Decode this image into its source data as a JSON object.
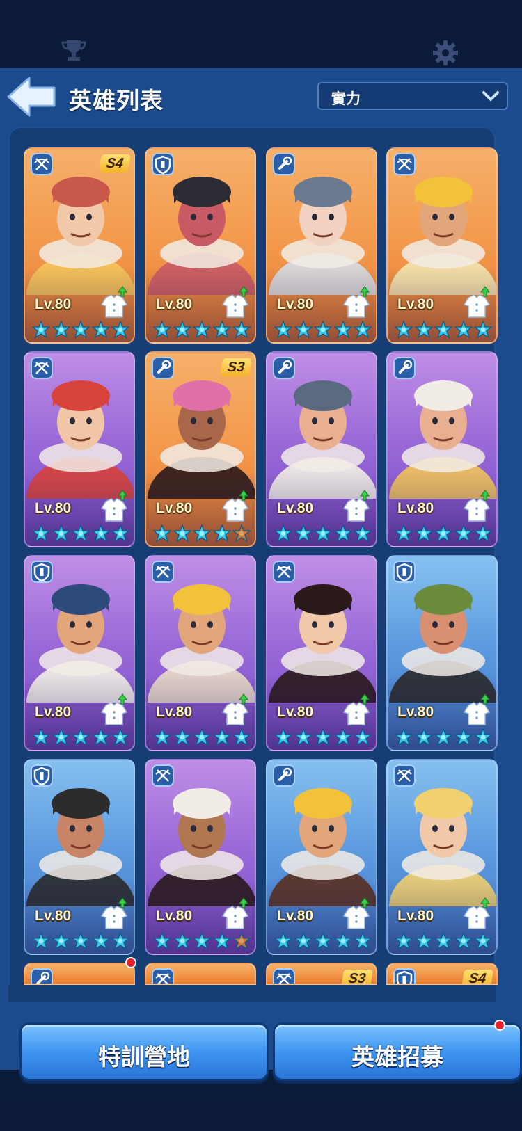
{
  "header": {
    "title": "英雄列表",
    "sort": {
      "selected": "實力"
    }
  },
  "heroes": [
    {
      "tier": "orange",
      "role": "crossbow-icon",
      "badge": "S4",
      "level": "Lv.80",
      "stars": 5,
      "skin": "#f1c9a8",
      "hat": "#c9584c",
      "hair": "#f2c45c"
    },
    {
      "tier": "orange",
      "role": "shield-icon",
      "badge": "",
      "level": "Lv.80",
      "stars": 5,
      "skin": "#c85a66",
      "hat": "#2c2c34",
      "hair": "#c85a66"
    },
    {
      "tier": "orange",
      "role": "wrench-icon",
      "badge": "",
      "level": "Lv.80",
      "stars": 5,
      "skin": "#f2d2c0",
      "hat": "#6a7a90",
      "hair": "#d6dbe6"
    },
    {
      "tier": "orange",
      "role": "crossbow-icon",
      "badge": "",
      "level": "Lv.80",
      "stars": 5,
      "skin": "#e2a67a",
      "hat": "#f2c23a",
      "hair": "#f2e6b0"
    },
    {
      "tier": "purple",
      "role": "crossbow-icon",
      "badge": "",
      "level": "Lv.80",
      "stars": 5,
      "skin": "#f1c6a6",
      "hat": "#d8443c",
      "hair": "#d8443c"
    },
    {
      "tier": "orange",
      "role": "wrench-icon",
      "badge": "S3",
      "level": "Lv.80",
      "stars": 4,
      "skin": "#a8664a",
      "hat": "#e070a8",
      "hair": "#2a1a1a"
    },
    {
      "tier": "purple",
      "role": "wrench-icon",
      "badge": "",
      "level": "Lv.80",
      "stars": 5,
      "skin": "#e8b090",
      "hat": "#5a6a80",
      "hair": "#f2efe6"
    },
    {
      "tier": "purple",
      "role": "wrench-icon",
      "badge": "",
      "level": "Lv.80",
      "stars": 5,
      "skin": "#e8b090",
      "hat": "#f2ece6",
      "hair": "#f2c45c"
    },
    {
      "tier": "purple",
      "role": "shield-icon",
      "badge": "",
      "level": "Lv.80",
      "stars": 5,
      "skin": "#e2a67a",
      "hat": "#2c4a7a",
      "hair": "#f2efe6"
    },
    {
      "tier": "purple",
      "role": "crossbow-icon",
      "badge": "",
      "level": "Lv.80",
      "stars": 5,
      "skin": "#e2a67a",
      "hat": "#f2c23a",
      "hair": "#e8dcc6"
    },
    {
      "tier": "purple",
      "role": "crossbow-icon",
      "badge": "",
      "level": "Lv.80",
      "stars": 5,
      "skin": "#f1c9a8",
      "hat": "#2a1a1a",
      "hair": "#2a1a1a"
    },
    {
      "tier": "blue",
      "role": "shield-icon",
      "badge": "",
      "level": "Lv.80",
      "stars": 5,
      "skin": "#d89070",
      "hat": "#6a8a3c",
      "hair": "#2a2a2a"
    },
    {
      "tier": "blue",
      "role": "shield-icon",
      "badge": "",
      "level": "Lv.80",
      "stars": 5,
      "skin": "#c88466",
      "hat": "#2c2c2c",
      "hair": "#2a2a2a"
    },
    {
      "tier": "purple",
      "role": "crossbow-icon",
      "badge": "",
      "level": "Lv.80",
      "stars": 4,
      "skin": "#b07850",
      "hat": "#f2ece6",
      "hair": "#2a1a1a"
    },
    {
      "tier": "blue",
      "role": "wrench-icon",
      "badge": "",
      "level": "Lv.80",
      "stars": 5,
      "skin": "#e2a67a",
      "hat": "#f2c23a",
      "hair": "#5a3020"
    },
    {
      "tier": "blue",
      "role": "crossbow-icon",
      "badge": "",
      "level": "Lv.80",
      "stars": 5,
      "skin": "#f1c9a8",
      "hat": "#f2d070",
      "hair": "#f2d070"
    }
  ],
  "peek_row": [
    {
      "tier": "orange",
      "role": "wrench-icon",
      "badge": "",
      "notify": true
    },
    {
      "tier": "orange",
      "role": "crossbow-icon",
      "badge": ""
    },
    {
      "tier": "orange",
      "role": "crossbow-icon",
      "badge": "S3"
    },
    {
      "tier": "orange",
      "role": "shield-icon",
      "badge": "S4"
    }
  ],
  "buttons": {
    "training": "特訓營地",
    "recruit": "英雄招募"
  },
  "colors": {
    "accent": "#2a74d6",
    "panel": "#163d74",
    "notify": "#e8202a"
  }
}
